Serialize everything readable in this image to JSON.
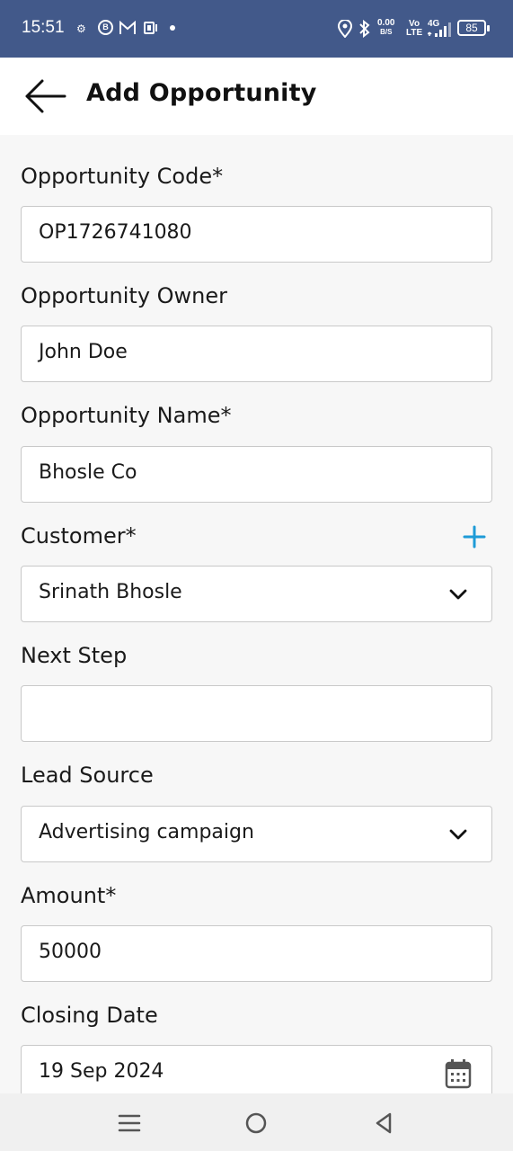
{
  "status_bar": {
    "time": "15:51",
    "network_speed_value": "0.00",
    "network_speed_unit": "B/S",
    "volte_top": "Vo",
    "volte_bottom": "LTE",
    "network_type": "4G",
    "battery_level": "85",
    "icons": [
      "settings-notification-icon",
      "b-app-icon",
      "gmail-icon",
      "cast-icon",
      "notification-dot",
      "location-icon",
      "bluetooth-icon",
      "signal-icon",
      "battery-icon"
    ]
  },
  "header": {
    "title": "Add Opportunity",
    "back_icon": "arrow-left-icon"
  },
  "form": {
    "opportunity_code": {
      "label": "Opportunity Code*",
      "value": "OP1726741080"
    },
    "opportunity_owner": {
      "label": "Opportunity Owner",
      "value": "John Doe"
    },
    "opportunity_name": {
      "label": "Opportunity Name*",
      "value": "Bhosle Co"
    },
    "customer": {
      "label": "Customer*",
      "value": "Srinath Bhosle",
      "add_icon": "plus-icon",
      "dropdown_icon": "chevron-down-icon"
    },
    "next_step": {
      "label": "Next Step",
      "value": ""
    },
    "lead_source": {
      "label": "Lead Source",
      "value": "Advertising campaign",
      "dropdown_icon": "chevron-down-icon"
    },
    "amount": {
      "label": "Amount*",
      "value": "50000"
    },
    "closing_date": {
      "label": "Closing Date",
      "value": "19 Sep 2024",
      "calendar_icon": "calendar-icon"
    }
  },
  "nav_bar": {
    "buttons": [
      "menu-icon",
      "home-icon",
      "back-triangle-icon"
    ]
  },
  "colors": {
    "status_bar_bg": "#42598a",
    "accent": "#1e9bd7",
    "page_bg": "#f7f7f7"
  }
}
